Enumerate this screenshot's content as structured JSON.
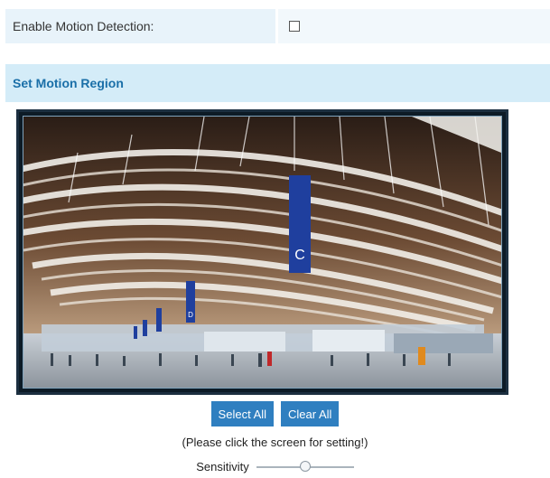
{
  "enable": {
    "label": "Enable Motion Detection:",
    "checked": false
  },
  "region": {
    "title": "Set Motion Region",
    "sign_c": "C",
    "sign_d": "D"
  },
  "buttons": {
    "select_all": "Select All",
    "clear_all": "Clear All"
  },
  "hint": "(Please click the screen for setting!)",
  "sensitivity": {
    "label": "Sensitivity",
    "value": 0.5
  }
}
